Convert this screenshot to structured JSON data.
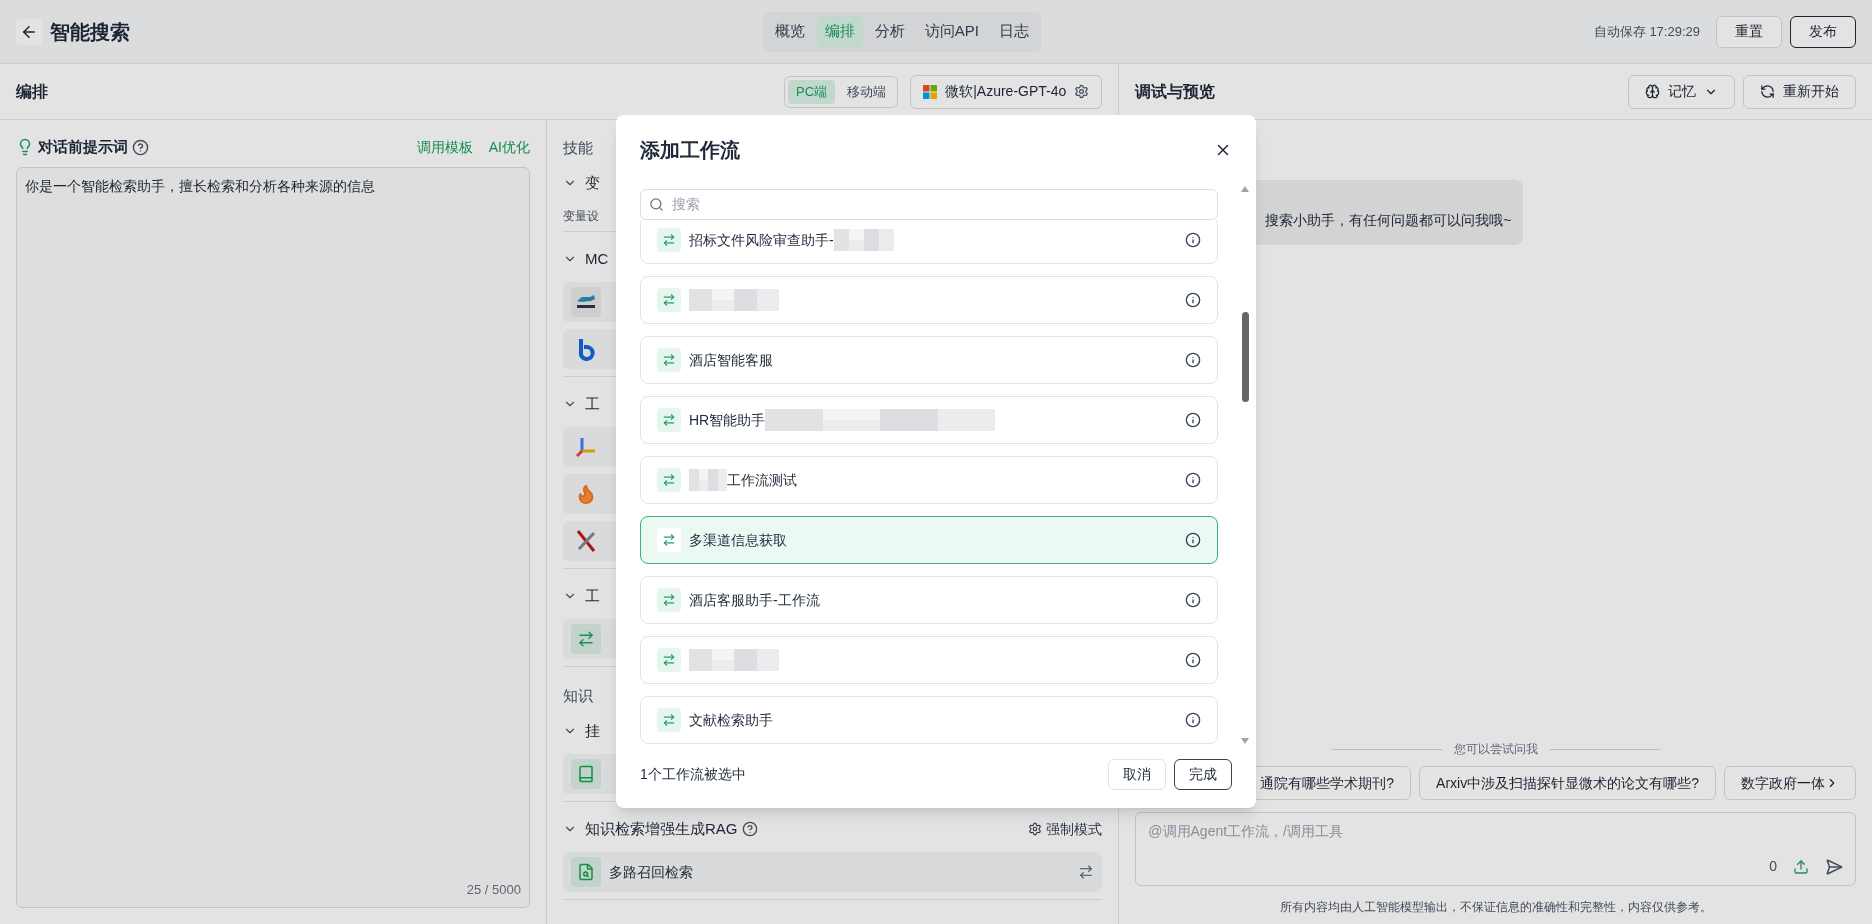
{
  "header": {
    "title": "智能搜索",
    "tabs": [
      {
        "label": "概览",
        "selected": false
      },
      {
        "label": "编排",
        "selected": true
      },
      {
        "label": "分析",
        "selected": false
      },
      {
        "label": "访问API",
        "selected": false
      },
      {
        "label": "日志",
        "selected": false
      }
    ],
    "autosave": "自动保存 17:29:29",
    "buttons": [
      {
        "label": "重置",
        "kind": "secondary"
      },
      {
        "label": "发布",
        "kind": "primary"
      }
    ]
  },
  "editor": {
    "title": "编排",
    "platforms": [
      {
        "label": "PC端",
        "selected": true
      },
      {
        "label": "移动端",
        "selected": false
      }
    ],
    "model": "微软|Azure-GPT-4o"
  },
  "prompt": {
    "title": "对话前提示词",
    "actions": [
      "调用模板",
      "AI优化"
    ],
    "value": "你是一个智能检索助手，擅长检索和分析各种来源的信息",
    "counter": "25 / 5000"
  },
  "skills": {
    "title": "技能",
    "sections": [
      {
        "label": "变",
        "note": "变量设"
      },
      {
        "label": "MC",
        "items": [
          {
            "kind": "fetch"
          },
          {
            "kind": "b"
          }
        ]
      },
      {
        "label": "工",
        "items": [
          {
            "kind": "axes"
          },
          {
            "kind": "flame"
          },
          {
            "kind": "cross"
          }
        ]
      },
      {
        "label": "工",
        "items": [
          {
            "kind": "workflow"
          }
        ]
      }
    ]
  },
  "knowledge": {
    "title": "知识",
    "sections": [
      {
        "label": "挂",
        "items": [
          {
            "kind": "book"
          }
        ]
      },
      {
        "label": "知识检索增强生成RAG",
        "help": true,
        "action": "强制模式",
        "items": [
          {
            "kind": "doc",
            "name": "多路召回检索"
          }
        ]
      }
    ]
  },
  "preview": {
    "title": "调试与预览",
    "buttons": [
      {
        "label": "记忆",
        "kind": "memory"
      },
      {
        "label": "重新开始",
        "kind": "restart"
      }
    ],
    "greeting": "搜索小助手，有任何问题都可以问我哦~",
    "suggest_label": "您可以尝试问我",
    "suggestions": [
      "通院有哪些学术期刊?",
      "Arxiv中涉及扫描探针显微术的论文有哪些?",
      "数字政府一体"
    ],
    "input": {
      "placeholder": "@调用Agent工作流，/调用工具",
      "count": "0"
    },
    "disclaimer": "所有内容均由人工智能模型输出，不保证信息的准确性和完整性，内容仅供参考。"
  },
  "modal": {
    "title": "添加工作流",
    "search": {
      "placeholder": "搜索"
    },
    "workflows": [
      {
        "name": "招标文件风险审查助手-",
        "kind": "tail",
        "selected": false
      },
      {
        "kind": "blank",
        "selected": false
      },
      {
        "name": "酒店智能客服",
        "kind": "plain",
        "selected": false
      },
      {
        "name": "HR智能助手",
        "kind": "long",
        "selected": false
      },
      {
        "name": "工作流测试",
        "kind": "head",
        "selected": false
      },
      {
        "name": "多渠道信息获取",
        "kind": "plain",
        "selected": true
      },
      {
        "name": "酒店客服助手-工作流",
        "kind": "plain",
        "selected": false
      },
      {
        "kind": "blank",
        "selected": false
      },
      {
        "name": "文献检索助手",
        "kind": "plain",
        "selected": false
      }
    ],
    "status": "1个工作流被选中",
    "buttons": [
      {
        "label": "取消",
        "kind": "secondary"
      },
      {
        "label": "完成",
        "kind": "primary"
      }
    ]
  }
}
